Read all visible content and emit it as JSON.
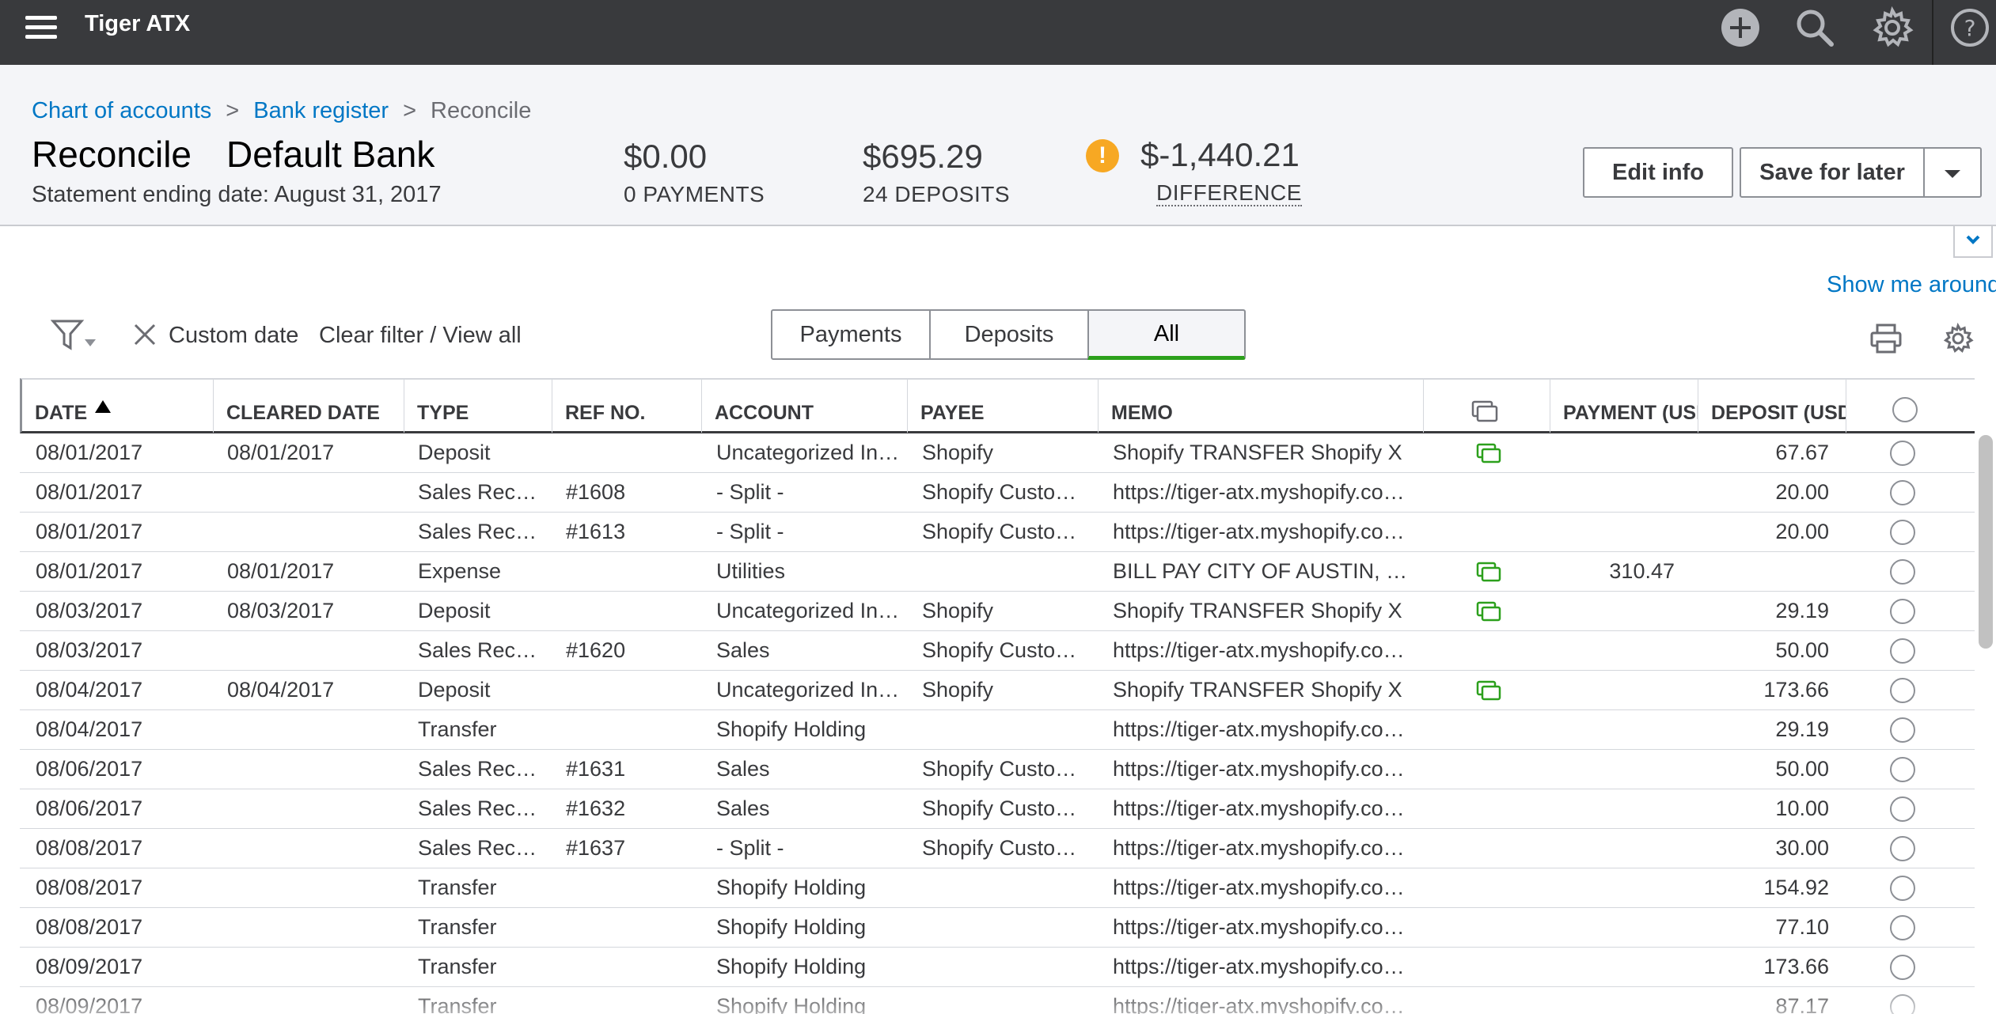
{
  "app": {
    "company_name": "Tiger ATX"
  },
  "topbar_icons": [
    "plus-circle-icon",
    "search-icon",
    "gear-icon",
    "help-icon"
  ],
  "breadcrumb": {
    "chart_of_accounts": "Chart of accounts",
    "bank_register": "Bank register",
    "current": "Reconcile",
    "separator": ">"
  },
  "header": {
    "title": "Reconcile",
    "account": "Default Bank",
    "statement_date": "Statement ending date: August 31, 2017",
    "payments_amount": "$0.00",
    "payments_label": "0 PAYMENTS",
    "deposits_amount": "$695.29",
    "deposits_label": "24 DEPOSITS",
    "difference_amount": "$-1,440.21",
    "difference_label": "DIFFERENCE",
    "warning_glyph": "!"
  },
  "buttons": {
    "edit_info": "Edit info",
    "save_for_later": "Save for later"
  },
  "show_me_around": "Show me around",
  "filter": {
    "custom_date": "Custom date",
    "clear_filter": "Clear filter / View all"
  },
  "tabs": [
    "Payments",
    "Deposits",
    "All"
  ],
  "active_tab": "All",
  "colors": {
    "topbar": "#393a3d",
    "link": "#0077c5",
    "accent_green": "#2ca01c",
    "warning": "#f7a823"
  },
  "table": {
    "headers": {
      "date": "DATE",
      "cleared_date": "CLEARED DATE",
      "type": "TYPE",
      "ref_no": "REF NO.",
      "account": "ACCOUNT",
      "payee": "PAYEE",
      "memo": "MEMO",
      "payment": "PAYMENT (USD)",
      "deposit": "DEPOSIT (USD)"
    },
    "rows": [
      {
        "date": "08/01/2017",
        "cleared": "08/01/2017",
        "type": "Deposit",
        "ref": "",
        "account": "Uncategorized Income",
        "payee": "Shopify",
        "memo": "Shopify TRANSFER Shopify X",
        "bank_icon": true,
        "payment": "",
        "deposit": "67.67"
      },
      {
        "date": "08/01/2017",
        "cleared": "",
        "type": "Sales Receipt",
        "ref": "#1608",
        "account": "- Split -",
        "payee": "Shopify Customer",
        "memo": "https://tiger-atx.myshopify.com/admin",
        "bank_icon": false,
        "payment": "",
        "deposit": "20.00"
      },
      {
        "date": "08/01/2017",
        "cleared": "",
        "type": "Sales Receipt",
        "ref": "#1613",
        "account": "- Split -",
        "payee": "Shopify Customer",
        "memo": "https://tiger-atx.myshopify.com/admin",
        "bank_icon": false,
        "payment": "",
        "deposit": "20.00"
      },
      {
        "date": "08/01/2017",
        "cleared": "08/01/2017",
        "type": "Expense",
        "ref": "",
        "account": "Utilities",
        "payee": "",
        "memo": "BILL PAY CITY OF AUSTIN, ONLINE",
        "bank_icon": true,
        "payment": "310.47",
        "deposit": ""
      },
      {
        "date": "08/03/2017",
        "cleared": "08/03/2017",
        "type": "Deposit",
        "ref": "",
        "account": "Uncategorized Income",
        "payee": "Shopify",
        "memo": "Shopify TRANSFER Shopify X",
        "bank_icon": true,
        "payment": "",
        "deposit": "29.19"
      },
      {
        "date": "08/03/2017",
        "cleared": "",
        "type": "Sales Receipt",
        "ref": "#1620",
        "account": "Sales",
        "payee": "Shopify Customer",
        "memo": "https://tiger-atx.myshopify.com/admin",
        "bank_icon": false,
        "payment": "",
        "deposit": "50.00"
      },
      {
        "date": "08/04/2017",
        "cleared": "08/04/2017",
        "type": "Deposit",
        "ref": "",
        "account": "Uncategorized Income",
        "payee": "Shopify",
        "memo": "Shopify TRANSFER Shopify X",
        "bank_icon": true,
        "payment": "",
        "deposit": "173.66"
      },
      {
        "date": "08/04/2017",
        "cleared": "",
        "type": "Transfer",
        "ref": "",
        "account": "Shopify Holding",
        "payee": "",
        "memo": "https://tiger-atx.myshopify.com/admin",
        "bank_icon": false,
        "payment": "",
        "deposit": "29.19"
      },
      {
        "date": "08/06/2017",
        "cleared": "",
        "type": "Sales Receipt",
        "ref": "#1631",
        "account": "Sales",
        "payee": "Shopify Customer",
        "memo": "https://tiger-atx.myshopify.com/admin",
        "bank_icon": false,
        "payment": "",
        "deposit": "50.00"
      },
      {
        "date": "08/06/2017",
        "cleared": "",
        "type": "Sales Receipt",
        "ref": "#1632",
        "account": "Sales",
        "payee": "Shopify Customer",
        "memo": "https://tiger-atx.myshopify.com/admin",
        "bank_icon": false,
        "payment": "",
        "deposit": "10.00"
      },
      {
        "date": "08/08/2017",
        "cleared": "",
        "type": "Sales Receipt",
        "ref": "#1637",
        "account": "- Split -",
        "payee": "Shopify Customer",
        "memo": "https://tiger-atx.myshopify.com/admin",
        "bank_icon": false,
        "payment": "",
        "deposit": "30.00"
      },
      {
        "date": "08/08/2017",
        "cleared": "",
        "type": "Transfer",
        "ref": "",
        "account": "Shopify Holding",
        "payee": "",
        "memo": "https://tiger-atx.myshopify.com/admin",
        "bank_icon": false,
        "payment": "",
        "deposit": "154.92"
      },
      {
        "date": "08/08/2017",
        "cleared": "",
        "type": "Transfer",
        "ref": "",
        "account": "Shopify Holding",
        "payee": "",
        "memo": "https://tiger-atx.myshopify.com/admin",
        "bank_icon": false,
        "payment": "",
        "deposit": "77.10"
      },
      {
        "date": "08/09/2017",
        "cleared": "",
        "type": "Transfer",
        "ref": "",
        "account": "Shopify Holding",
        "payee": "",
        "memo": "https://tiger-atx.myshopify.com/admin",
        "bank_icon": false,
        "payment": "",
        "deposit": "173.66"
      },
      {
        "date": "08/09/2017",
        "cleared": "",
        "type": "Transfer",
        "ref": "",
        "account": "Shopify Holding",
        "payee": "",
        "memo": "https://tiger-atx.myshopify.com/admin",
        "bank_icon": false,
        "payment": "",
        "deposit": "87.17"
      }
    ]
  }
}
